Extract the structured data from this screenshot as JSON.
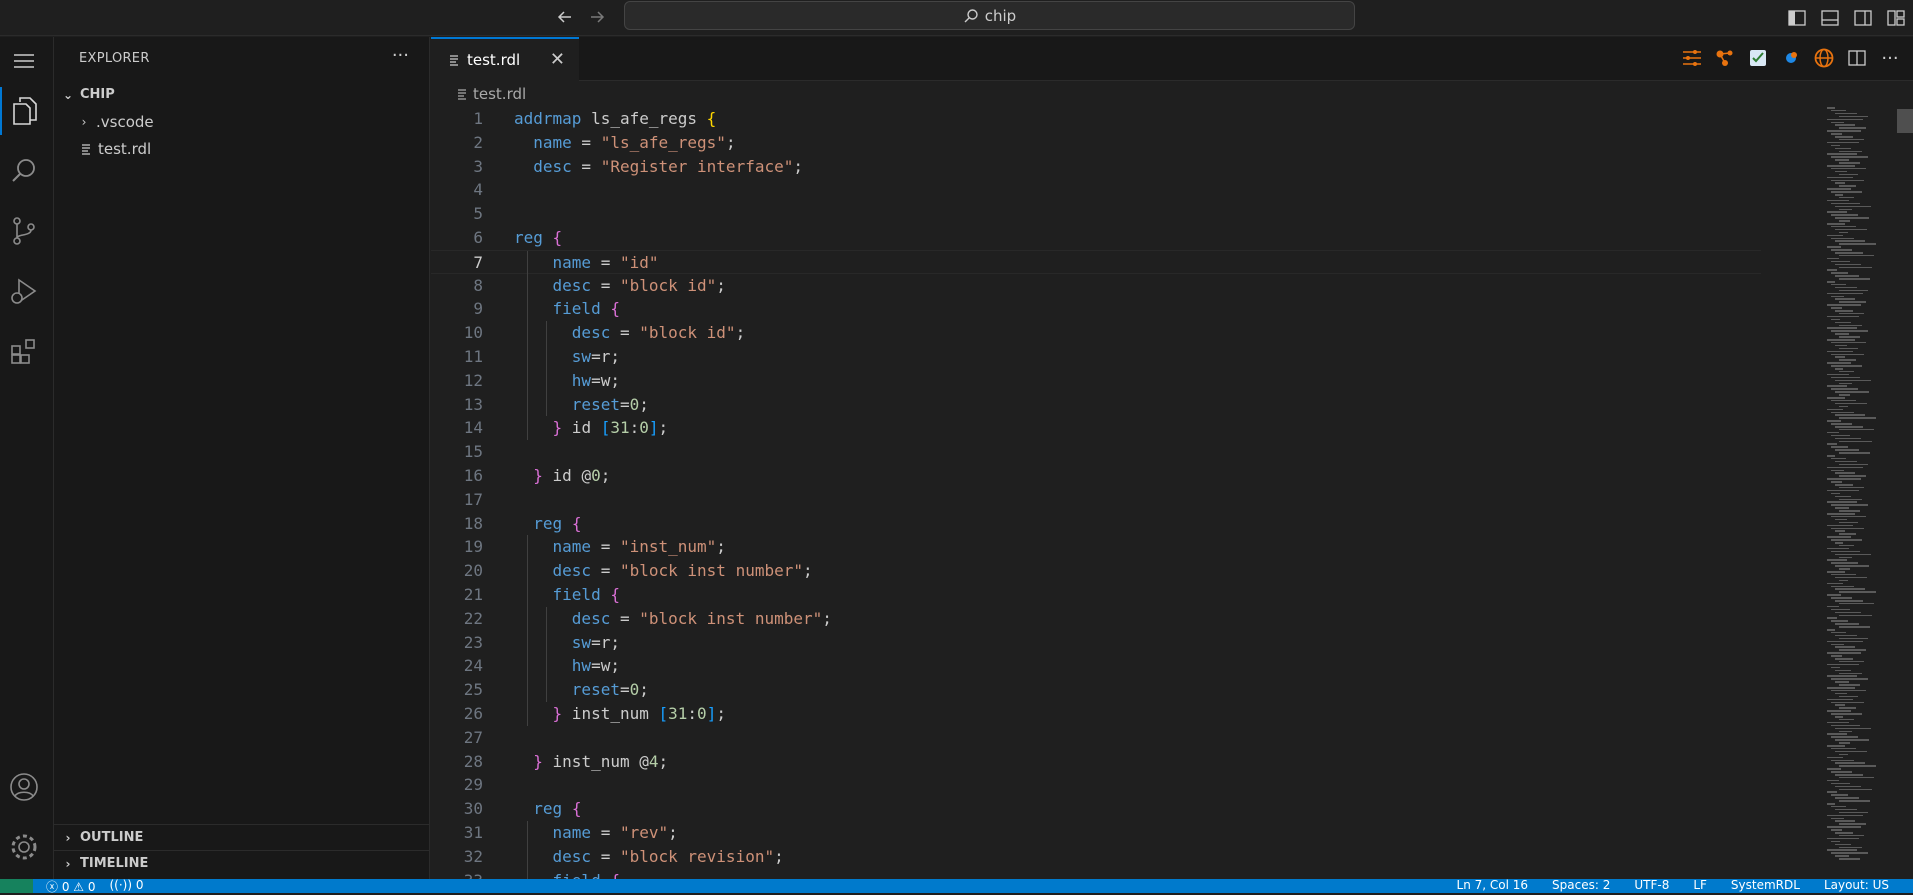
{
  "title": {
    "search_text": "chip",
    "back_icon": "arrow-left-icon",
    "forward_icon": "arrow-right-icon"
  },
  "sidebar": {
    "title": "EXPLORER",
    "more": "···",
    "folder": "CHIP",
    "items": [
      {
        "label": ".vscode",
        "type": "folder"
      },
      {
        "label": "test.rdl",
        "type": "file"
      }
    ],
    "outline": "OUTLINE",
    "timeline": "TIMELINE"
  },
  "editor": {
    "tab_label": "test.rdl",
    "close": "✕",
    "breadcrumb": "test.rdl",
    "lines": [
      "addrmap ls_afe_regs {",
      "  name = \"ls_afe_regs\";",
      "  desc = \"Register interface\";",
      "",
      "",
      "reg {",
      "    name = \"id\"",
      "    desc = \"block id\";",
      "    field {",
      "      desc = \"block id\";",
      "      sw=r;",
      "      hw=w;",
      "      reset=0;",
      "    } id [31:0];",
      "",
      "  } id @0;",
      "",
      "  reg {",
      "    name = \"inst_num\";",
      "    desc = \"block inst number\";",
      "    field {",
      "      desc = \"block inst number\";",
      "      sw=r;",
      "      hw=w;",
      "      reset=0;",
      "    } inst_num [31:0];",
      "",
      "  } inst_num @4;",
      "",
      "  reg {",
      "    name = \"rev\";",
      "    desc = \"block revision\";",
      "    field {"
    ]
  },
  "status": {
    "errors": "0",
    "warnings": "0",
    "ports": "0",
    "position": "Ln 7, Col 16",
    "spaces": "Spaces: 2",
    "encoding": "UTF-8",
    "eol": "LF",
    "language": "SystemRDL",
    "layout": "Layout: US"
  },
  "colors": {
    "accent": "#0078d4",
    "statusbar": "#007acc",
    "keyword": "#569cd6",
    "string": "#ce9178",
    "number": "#b5cea8"
  }
}
